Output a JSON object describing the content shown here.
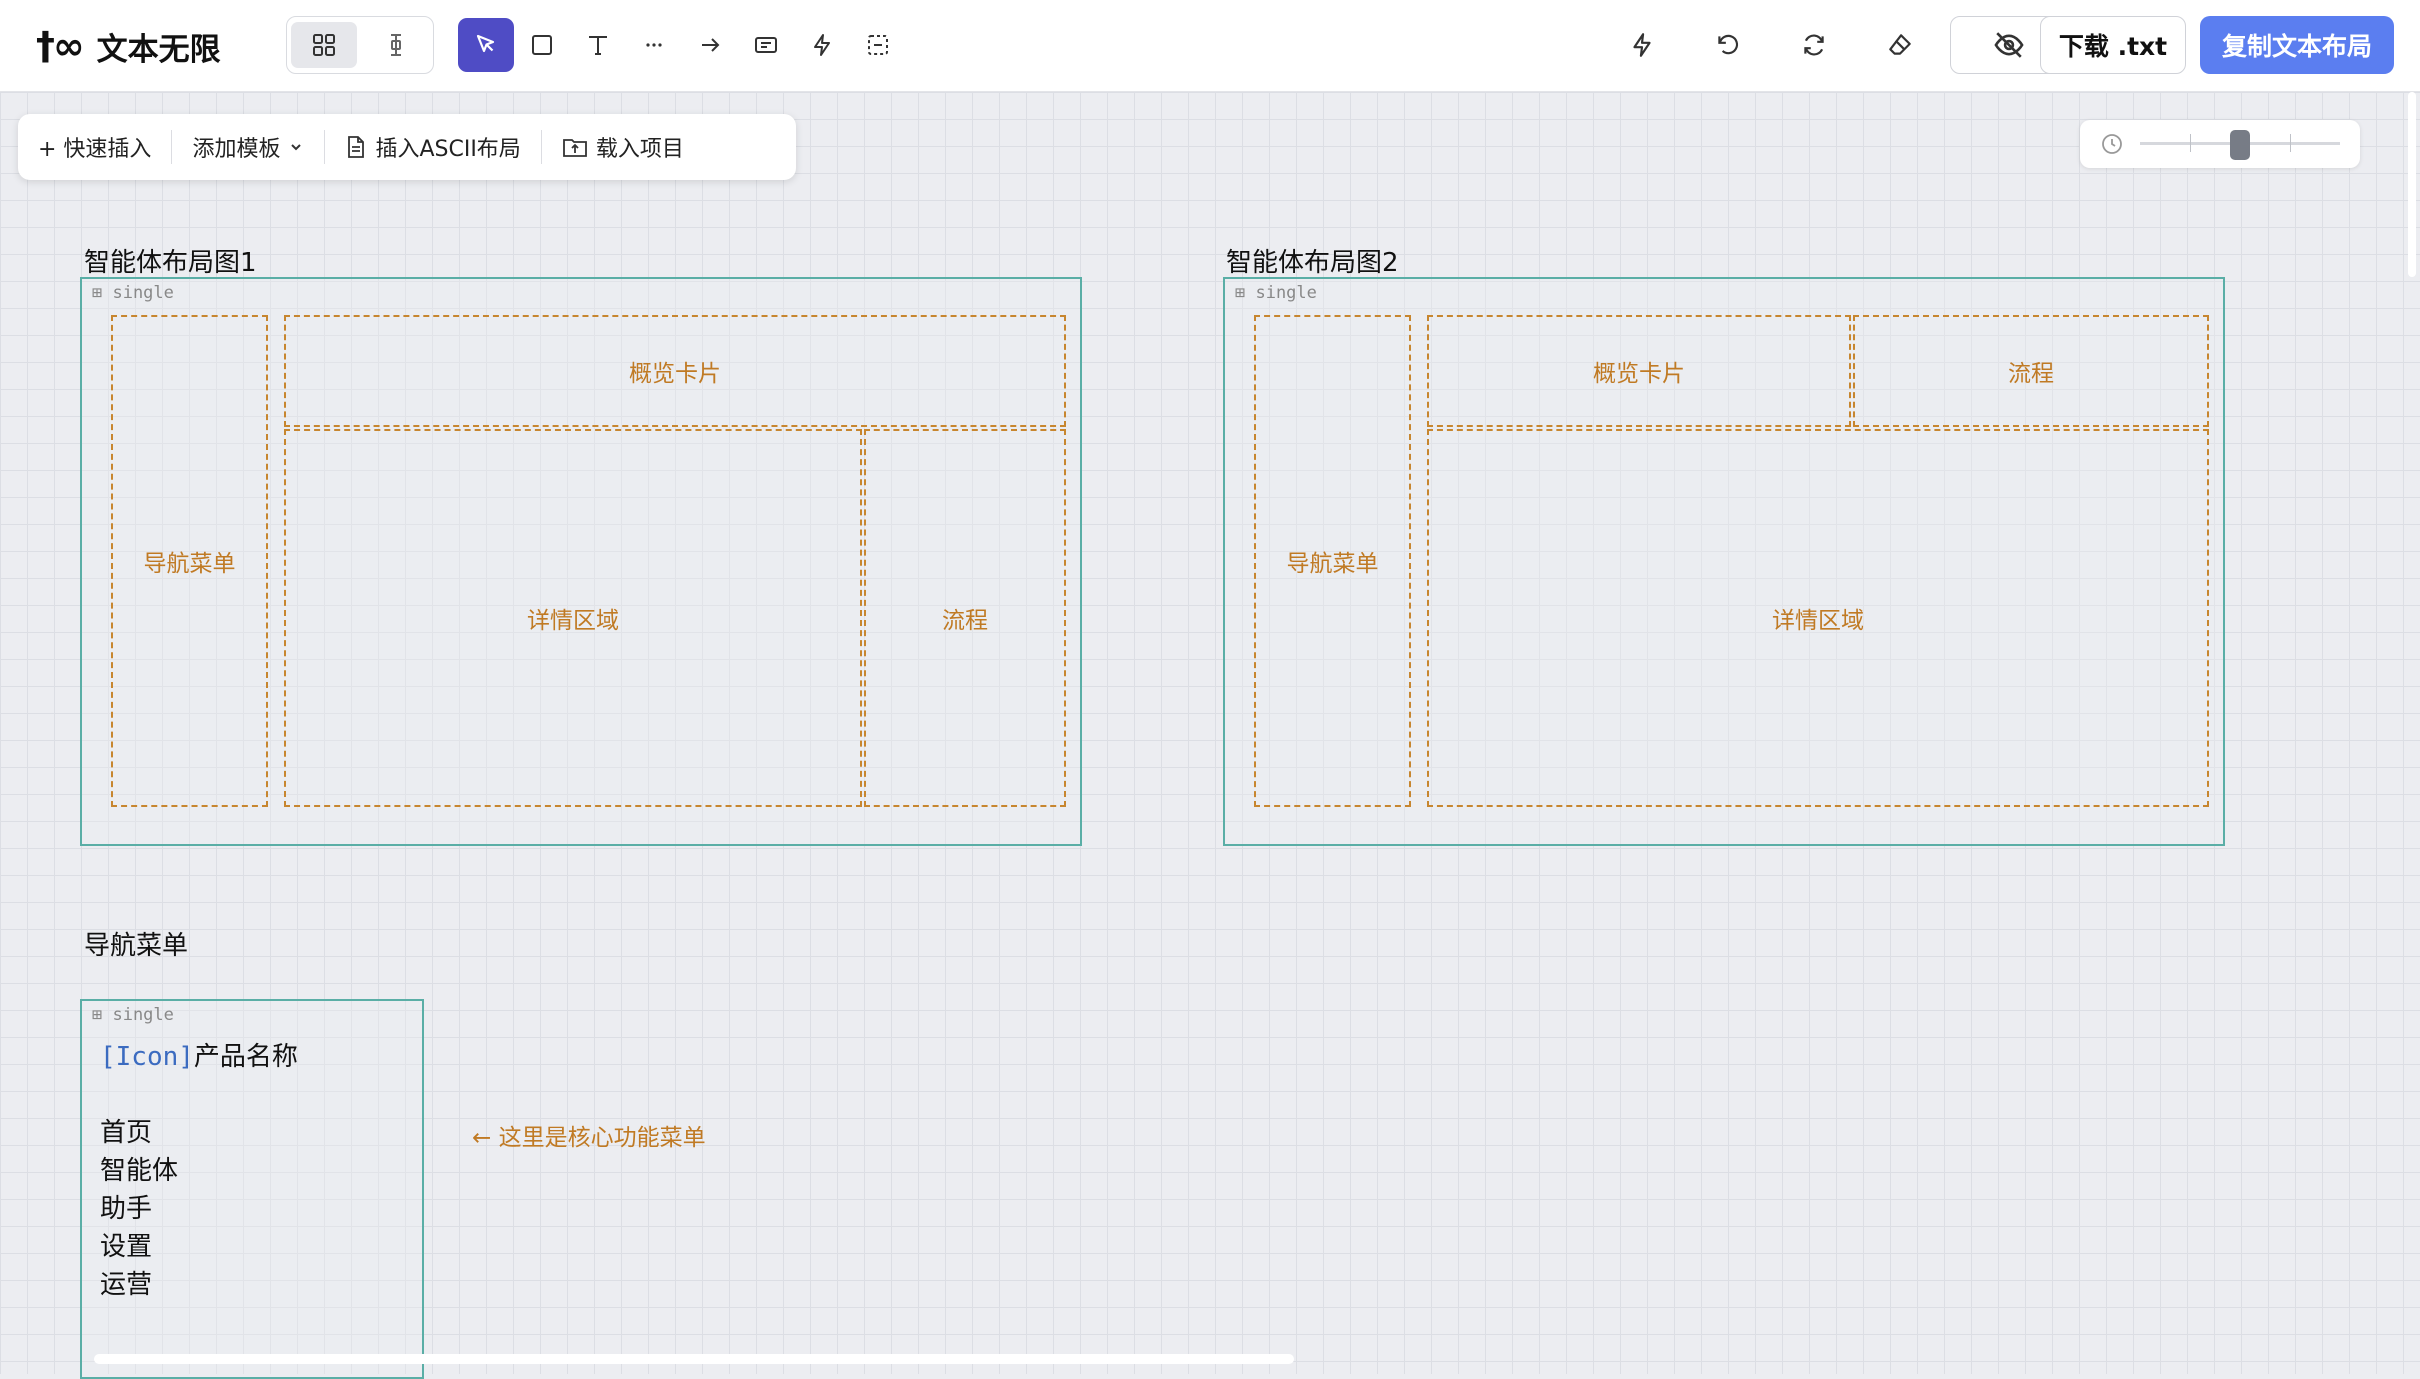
{
  "app": {
    "logo_mark": "†∞",
    "name": "文本无限"
  },
  "toolbar": {
    "tools": [
      {
        "name": "select-tool",
        "icon": "cursor-icon",
        "active": true
      },
      {
        "name": "rectangle-tool",
        "icon": "square-icon"
      },
      {
        "name": "text-tool",
        "icon": "text-T-icon"
      },
      {
        "name": "dots-tool",
        "icon": "ellipsis-icon"
      },
      {
        "name": "arrow-tool",
        "icon": "arrow-right-icon"
      },
      {
        "name": "textbox-tool",
        "icon": "textbox-icon"
      },
      {
        "name": "action-tool",
        "icon": "lightning-icon"
      },
      {
        "name": "group-tool",
        "icon": "dashed-square-icon"
      }
    ],
    "download_label": "下载 .txt",
    "copy_label": "复制文本布局"
  },
  "insert_bar": {
    "quick_insert": "+ 快速插入",
    "add_template": "添加模板",
    "insert_ascii": "插入ASCII布局",
    "load_project": "载入项目"
  },
  "zoom": {
    "level": 0.5
  },
  "frames": [
    {
      "title": "智能体布局图1",
      "tag": "⊞ single",
      "regions": [
        "导航菜单",
        "概览卡片",
        "详情区域",
        "流程"
      ]
    },
    {
      "title": "智能体布局图2",
      "tag": "⊞ single",
      "regions": [
        "导航菜单",
        "概览卡片",
        "流程",
        "详情区域"
      ]
    },
    {
      "title": "导航菜单",
      "tag": "⊞ single",
      "icon_tag": "[Icon]",
      "product_name": "产品名称",
      "menu_items": [
        "首页",
        "智能体",
        "助手",
        "设置",
        "运营"
      ],
      "note": "← 这里是核心功能菜单"
    }
  ],
  "colors": {
    "frame_border": "#5aaea6",
    "region_border": "#c7862f",
    "primary": "#5b7ef0",
    "active_tool": "#4f4cc5"
  }
}
